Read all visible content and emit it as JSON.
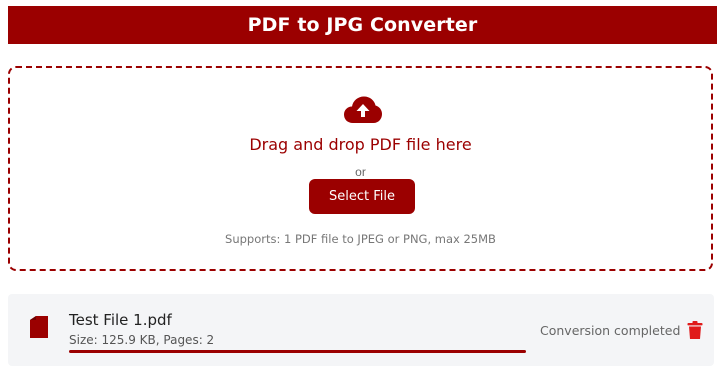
{
  "header": {
    "title": "PDF to JPG Converter"
  },
  "dropzone": {
    "title": "Drag and drop PDF file here",
    "or_text": "or",
    "select_button": "Select File",
    "supports_text": "Supports: 1 PDF file to JPEG or PNG, max 25MB",
    "icon": "cloud-upload-icon"
  },
  "file": {
    "name": "Test File 1.pdf",
    "meta": "Size: 125.9 KB, Pages: 2",
    "status": "Conversion completed",
    "progress_percent": 100,
    "file_icon": "pdf-file-icon",
    "delete_icon": "trash-icon"
  },
  "colors": {
    "accent": "#9b0000",
    "row_background": "#f4f5f7"
  }
}
